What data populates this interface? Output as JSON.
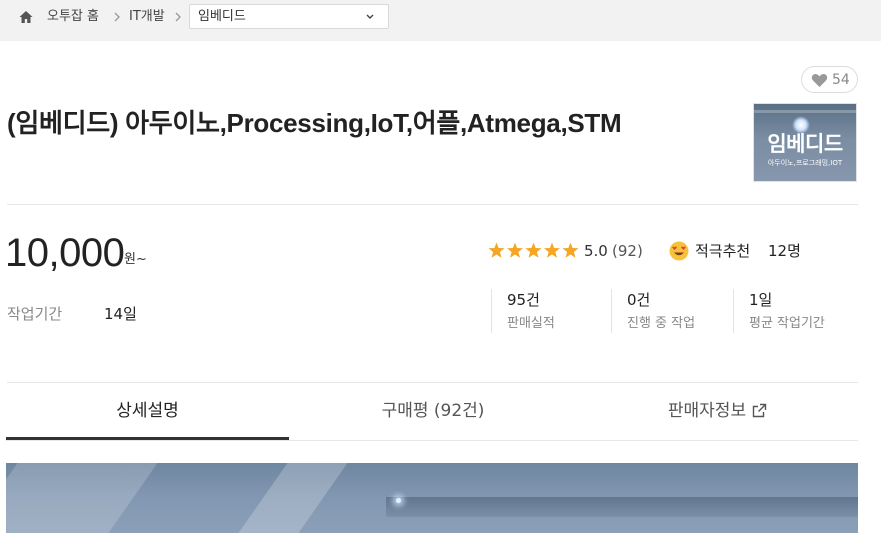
{
  "breadcrumb": {
    "home": "오투잡 홈",
    "category": "IT개발",
    "subcategory": "임베디드"
  },
  "like": {
    "count": "54"
  },
  "gig": {
    "title": "(임베디드) 아두이노,Processing,IoT,어플,Atmega,STM",
    "thumbnail": {
      "title": "임베디드",
      "subtitle": "아두이노,프로그래밍,IOT"
    }
  },
  "price": {
    "amount": "10,000",
    "unit": "원~"
  },
  "rating": {
    "score": "5.0",
    "count": "(92)",
    "stars": 5
  },
  "recommend": {
    "label": "적극추천",
    "count": "12명"
  },
  "work_period": {
    "label": "작업기간",
    "value": "14일"
  },
  "stats": [
    {
      "value": "95건",
      "label": "판매실적"
    },
    {
      "value": "0건",
      "label": "진행 중 작업"
    },
    {
      "value": "1일",
      "label": "평균 작업기간"
    }
  ],
  "tabs": [
    {
      "label": "상세설명",
      "active": true
    },
    {
      "label": "구매평 (92건)",
      "active": false
    },
    {
      "label": "판매자정보",
      "active": false
    }
  ],
  "colors": {
    "accent_star": "#f5a623",
    "text": "#222222",
    "muted": "#888888"
  }
}
